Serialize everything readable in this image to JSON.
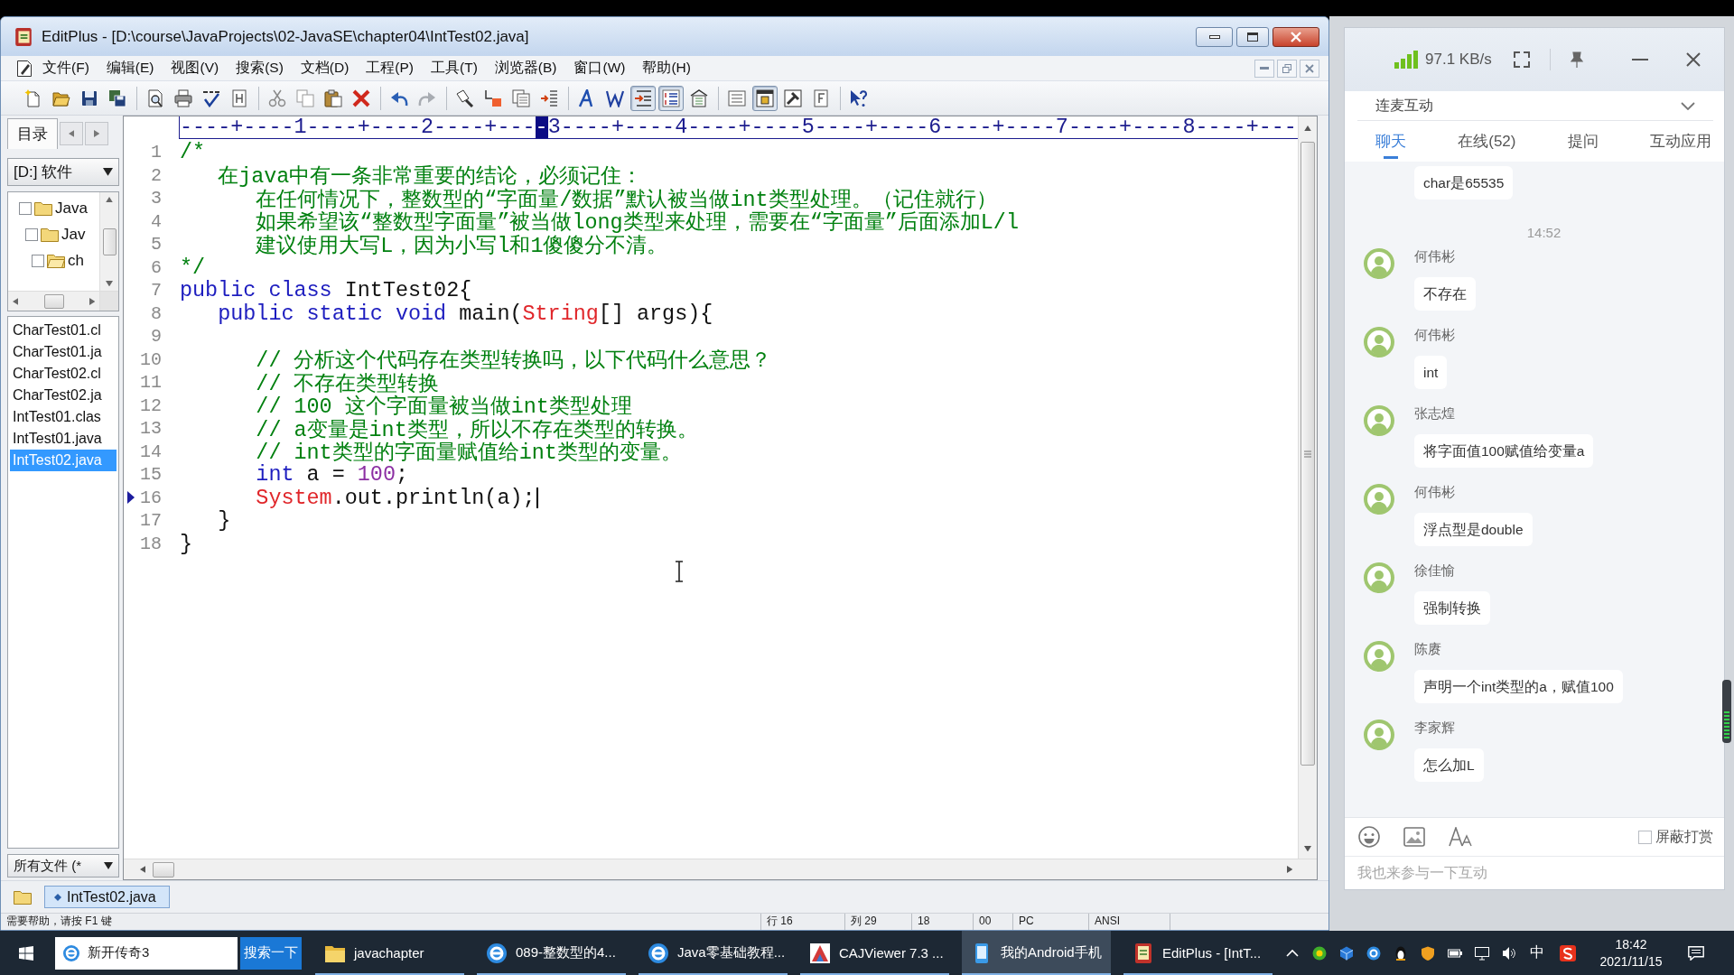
{
  "window": {
    "title": "EditPlus - [D:\\course\\JavaProjects\\02-JavaSE\\chapter04\\IntTest02.java]"
  },
  "menu": [
    "文件(F)",
    "编辑(E)",
    "视图(V)",
    "搜索(S)",
    "文档(D)",
    "工程(P)",
    "工具(T)",
    "浏览器(B)",
    "窗口(W)",
    "帮助(H)"
  ],
  "toolbar": [
    [
      {
        "pressed": false
      },
      {
        "pressed": false
      },
      {
        "pressed": false
      },
      {
        "pressed": false
      }
    ],
    [
      {
        "pressed": false
      },
      {
        "pressed": false
      },
      {
        "pressed": false
      },
      {
        "pressed": false
      }
    ],
    [
      {
        "pressed": false
      },
      {
        "pressed": false
      },
      {
        "pressed": false
      },
      {
        "pressed": false
      }
    ],
    [
      {
        "pressed": false
      },
      {
        "pressed": false
      }
    ],
    [
      {
        "pressed": false
      },
      {
        "pressed": false
      },
      {
        "pressed": false
      },
      {
        "pressed": false
      }
    ],
    [
      {
        "pressed": false
      },
      {
        "pressed": false
      },
      {
        "pressed": true
      },
      {
        "pressed": true
      },
      {
        "pressed": false
      }
    ],
    [
      {
        "pressed": false
      },
      {
        "pressed": true
      },
      {
        "pressed": false
      },
      {
        "pressed": false
      }
    ],
    [
      {
        "pressed": false
      }
    ]
  ],
  "sidebar": {
    "tabs": [
      {
        "label": "目录",
        "selected": true
      }
    ],
    "drive": "[D:] 软件",
    "tree": [
      {
        "label": "Java",
        "open": false,
        "children": [
          {
            "label": "Jav",
            "open": false,
            "children": [
              {
                "label": "ch",
                "open": true
              }
            ]
          }
        ]
      }
    ],
    "files": [
      {
        "name": "CharTest01.cl",
        "selected": false
      },
      {
        "name": "CharTest01.ja",
        "selected": false
      },
      {
        "name": "CharTest02.cl",
        "selected": false
      },
      {
        "name": "CharTest02.ja",
        "selected": false
      },
      {
        "name": "IntTest01.clas",
        "selected": false
      },
      {
        "name": "IntTest01.java",
        "selected": false
      },
      {
        "name": "IntTest02.java",
        "selected": true
      }
    ],
    "filter": "所有文件 (*"
  },
  "editor": {
    "ruler": {
      "before": "----+----1----+----2----+---",
      "cursor": "-",
      "after": "3----+----4----+----5----+----6----+----7----+----8----+---"
    },
    "lines": [
      {
        "number": "1",
        "current": false,
        "tokens": [
          {
            "text": "/*",
            "kind": "comment"
          }
        ],
        "children": [
          {
            "number": "2",
            "current": false,
            "tokens": [
              {
                "text": "在java中有一条非常重要的结论，必须记住：",
                "kind": "comment"
              }
            ],
            "children": [
              {
                "number": "3",
                "current": false,
                "tokens": [
                  {
                    "text": "在任何情况下，整数型的“字面量/数据”默认被当做int类型处理。（记住就行）",
                    "kind": "comment"
                  }
                ]
              },
              {
                "number": "4",
                "current": false,
                "tokens": [
                  {
                    "text": "如果希望该“整数型字面量”被当做long类型来处理，需要在“字面量”后面添加L/l",
                    "kind": "comment"
                  }
                ]
              },
              {
                "number": "5",
                "current": false,
                "tokens": [
                  {
                    "text": "建议使用大写L，因为小写l和1傻傻分不清。",
                    "kind": "comment"
                  }
                ]
              }
            ]
          }
        ]
      },
      {
        "number": "6",
        "current": false,
        "tokens": [
          {
            "text": "*/",
            "kind": "comment"
          }
        ]
      },
      {
        "number": "7",
        "current": false,
        "tokens": [
          {
            "text": "public class",
            "kind": "keyword"
          },
          {
            "text": " IntTest02{",
            "kind": "plain"
          }
        ],
        "children": [
          {
            "number": "8",
            "current": false,
            "tokens": [
              {
                "text": "public static void",
                "kind": "keyword"
              },
              {
                "text": " main(",
                "kind": "plain"
              },
              {
                "text": "String",
                "kind": "type"
              },
              {
                "text": "[] args){",
                "kind": "plain"
              }
            ],
            "children": [
              {
                "number": "9",
                "current": false
              },
              {
                "number": "10",
                "current": false,
                "tokens": [
                  {
                    "text": "// 分析这个代码存在类型转换吗，以下代码什么意思？",
                    "kind": "comment"
                  }
                ]
              },
              {
                "number": "11",
                "current": false,
                "tokens": [
                  {
                    "text": "// 不存在类型转换",
                    "kind": "comment"
                  }
                ]
              },
              {
                "number": "12",
                "current": false,
                "tokens": [
                  {
                    "text": "// 100 这个字面量被当做int类型处理",
                    "kind": "comment"
                  }
                ]
              },
              {
                "number": "13",
                "current": false,
                "tokens": [
                  {
                    "text": "// a变量是int类型，所以不存在类型的转换。",
                    "kind": "comment"
                  }
                ]
              },
              {
                "number": "14",
                "current": false,
                "tokens": [
                  {
                    "text": "// int类型的字面量赋值给int类型的变量。",
                    "kind": "comment"
                  }
                ]
              },
              {
                "number": "15",
                "current": false,
                "tokens": [
                  {
                    "text": "int",
                    "kind": "keyword"
                  },
                  {
                    "text": " a = ",
                    "kind": "plain"
                  },
                  {
                    "text": "100",
                    "kind": "number"
                  },
                  {
                    "text": ";",
                    "kind": "plain"
                  }
                ]
              },
              {
                "number": "16",
                "current": true,
                "tokens": [
                  {
                    "text": "System",
                    "kind": "type"
                  },
                  {
                    "text": ".out.println(a);",
                    "kind": "plain"
                  }
                ]
              }
            ]
          },
          {
            "number": "17",
            "current": false,
            "tokens": [
              {
                "text": "}",
                "kind": "plain"
              }
            ]
          }
        ]
      },
      {
        "number": "18",
        "current": false,
        "tokens": [
          {
            "text": "}",
            "kind": "plain"
          }
        ]
      }
    ]
  },
  "file_tabs": [
    {
      "label": "IntTest02.java",
      "selected": true
    }
  ],
  "status_bar": [
    "需要帮助，请按 F1 键",
    "行 16",
    "列 29",
    "18",
    "00",
    "PC",
    "ANSI"
  ],
  "chat": {
    "speed": "97.1 KB/s",
    "section": "连麦互动",
    "tabs": [
      {
        "label": "聊天",
        "selected": true
      },
      {
        "label": "在线(52)",
        "selected": false
      },
      {
        "label": "提问",
        "selected": false
      },
      {
        "label": "互动应用",
        "selected": false
      }
    ],
    "messages": [
      {
        "kind": "message",
        "text": "char是65535"
      },
      {
        "kind": "time",
        "text": "14:52"
      },
      {
        "kind": "message",
        "name": "何伟彬",
        "text": "不存在"
      },
      {
        "kind": "message",
        "name": "何伟彬",
        "text": "int"
      },
      {
        "kind": "message",
        "name": "张志煌",
        "text": "将字面值100赋值给变量a"
      },
      {
        "kind": "message",
        "name": "何伟彬",
        "text": "浮点型是double"
      },
      {
        "kind": "message",
        "name": "徐佳愉",
        "text": "强制转换"
      },
      {
        "kind": "message",
        "name": "陈赓",
        "text": "声明一个int类型的a，赋值100"
      },
      {
        "kind": "message",
        "name": "李家辉",
        "text": "怎么加L"
      }
    ],
    "block_gifts": {
      "label": "屏蔽打赏",
      "checked": false
    },
    "input": {
      "placeholder": "我也来参与一下互动"
    }
  },
  "taskbar": {
    "search": {
      "value": "新开传奇3",
      "button": "搜索一下"
    },
    "items": [
      {
        "label": "javachapter",
        "selected": false
      },
      {
        "label": "089-整数型的4...",
        "selected": false
      },
      {
        "label": "Java零基础教程...",
        "selected": false
      },
      {
        "label": "CAJViewer 7.3 ...",
        "selected": false
      },
      {
        "label": "我的Android手机",
        "selected": true
      },
      {
        "label": "EditPlus - [IntT...",
        "selected": false
      }
    ],
    "ime": "中",
    "time": "18:42",
    "date": "2021/11/15"
  }
}
